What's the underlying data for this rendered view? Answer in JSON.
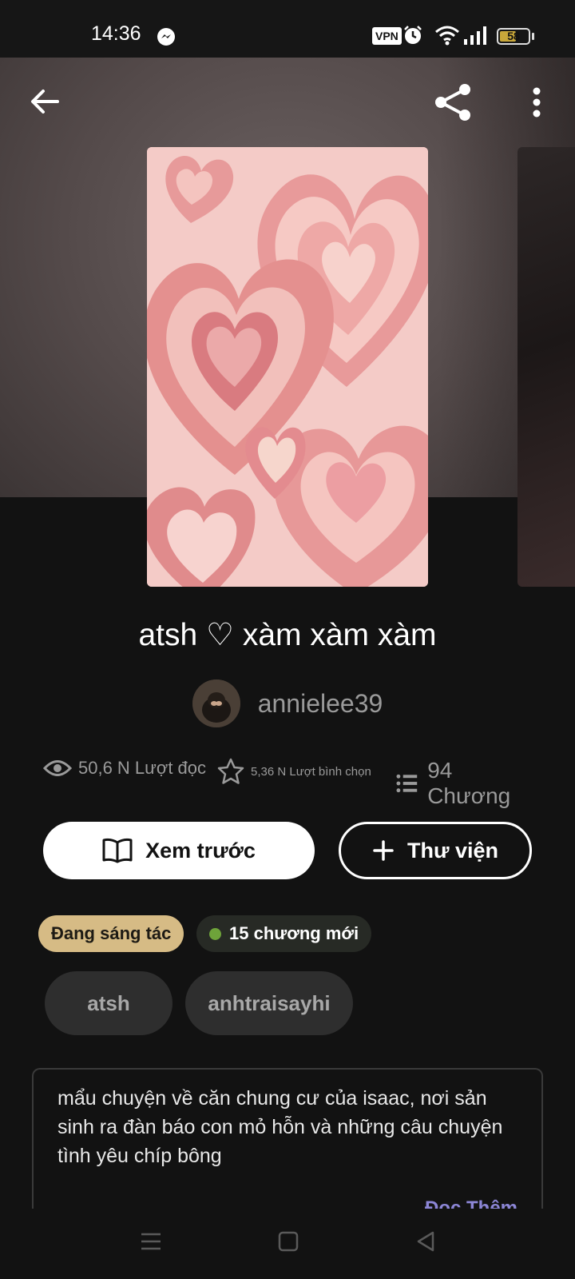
{
  "status_bar": {
    "time": "14:36",
    "vpn": "VPN",
    "battery": "58",
    "battery_level": 0.58,
    "icons": [
      "messenger-icon",
      "alarm-icon",
      "wifi-icon",
      "signal-icon",
      "battery-icon"
    ]
  },
  "header": {
    "back_icon": "arrow-left-icon",
    "share_icon": "share-icon",
    "more_icon": "more-vertical-icon"
  },
  "story": {
    "title": "atsh ♡ xàm xàm xàm",
    "author": "annielee39",
    "stats": {
      "reads": "50,6 N Lượt đọc",
      "votes": "5,36 N Lượt bình chọn",
      "parts": "94 Chương"
    },
    "description": "mẩu chuyện về căn chung cư của isaac, nơi sản sinh ra đàn báo con mỏ hỗn và những câu chuyện tình yêu chíp bông",
    "read_more": "Đọc Thêm"
  },
  "actions": {
    "preview": "Xem trước",
    "library": "Thư viện"
  },
  "badges": {
    "status": "Đang sáng tác",
    "new_chapters": "15 chương mới"
  },
  "tags": [
    "atsh",
    "anhtraisayhi"
  ],
  "colors": {
    "background": "#121212",
    "status_badge": "#d6bb85",
    "new_dot": "#6ea33a",
    "read_more": "#8c86d6",
    "cover_pink": "#f3c9c6"
  }
}
